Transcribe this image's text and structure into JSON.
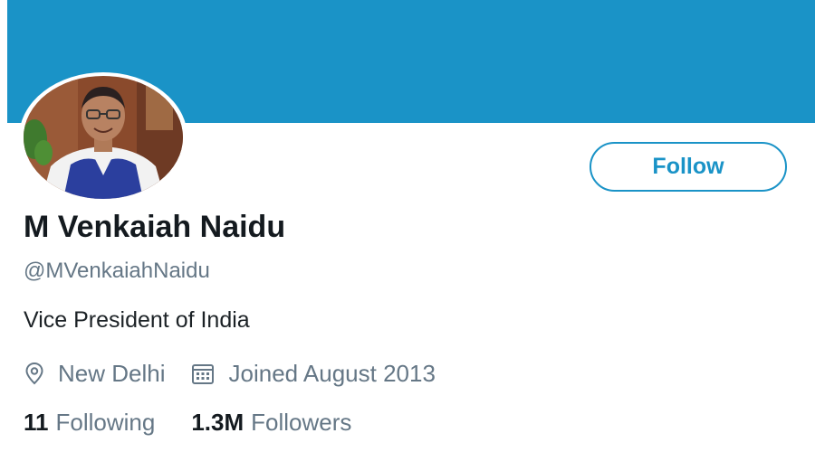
{
  "profile": {
    "display_name": "M Venkaiah Naidu",
    "handle": "@MVenkaiahNaidu",
    "bio": "Vice President of India",
    "location": "New Delhi",
    "joined": "Joined August 2013",
    "follow_label": "Follow"
  },
  "stats": {
    "following_count": "11",
    "following_label": "Following",
    "followers_count": "1.3M",
    "followers_label": "Followers"
  },
  "icons": {
    "location": "map-pin-icon",
    "joined": "calendar-icon"
  },
  "colors": {
    "banner": "#1a93c7",
    "accent": "#1a93c7",
    "primary_text": "#141a1f",
    "secondary_text": "#657786"
  }
}
